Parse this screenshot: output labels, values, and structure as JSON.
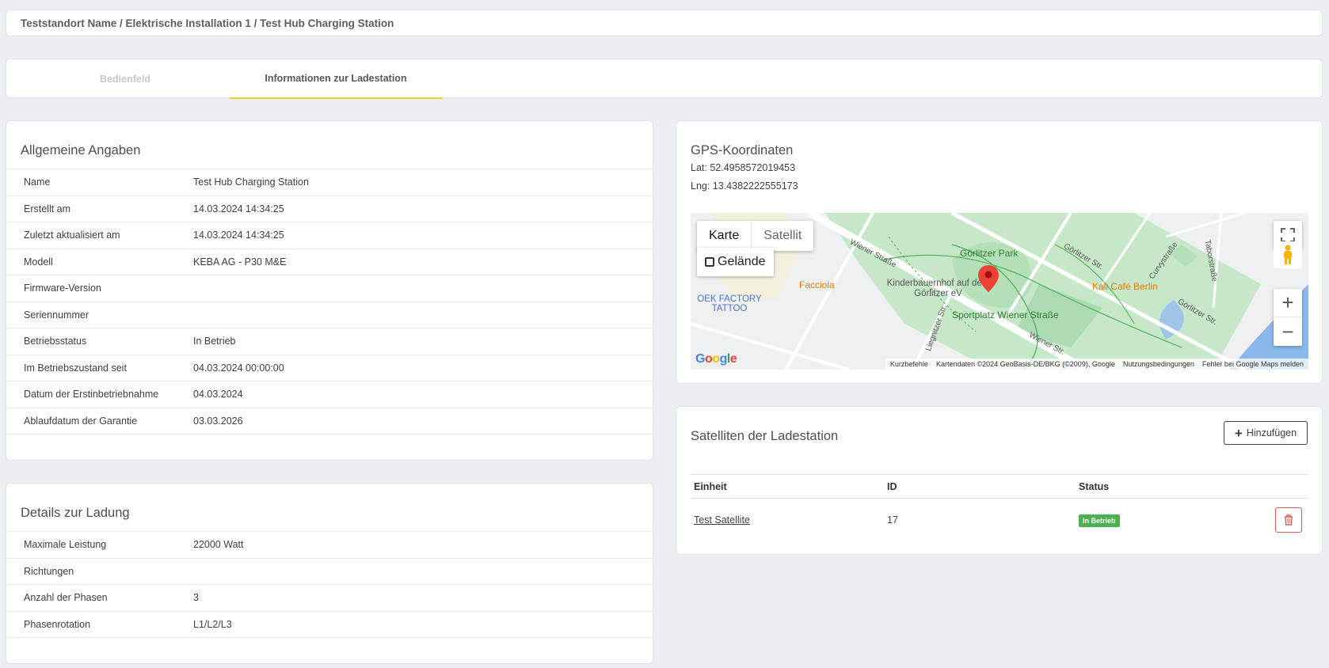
{
  "breadcrumb": "Teststandort Name / Elektrische Installation 1 / Test Hub Charging Station",
  "tabs": [
    {
      "label": "Bedienfeld",
      "active": false
    },
    {
      "label": "Informationen zur Ladestation",
      "active": true
    }
  ],
  "general": {
    "title": "Allgemeine Angaben",
    "rows": [
      {
        "key": "Name",
        "value": "Test Hub Charging Station"
      },
      {
        "key": "Erstellt am",
        "value": "14.03.2024 14:34:25"
      },
      {
        "key": "Zuletzt aktualisiert am",
        "value": "14.03.2024 14:34:25"
      },
      {
        "key": "Modell",
        "value": "KEBA AG - P30 M&E"
      },
      {
        "key": "Firmware-Version",
        "value": ""
      },
      {
        "key": "Seriennummer",
        "value": ""
      },
      {
        "key": "Betriebsstatus",
        "value": "In Betrieb"
      },
      {
        "key": "Im Betriebszustand seit",
        "value": "04.03.2024 00:00:00"
      },
      {
        "key": "Datum der Erstinbetriebnahme",
        "value": "04.03.2024"
      },
      {
        "key": "Ablaufdatum der Garantie",
        "value": "03.03.2026"
      }
    ]
  },
  "charging": {
    "title": "Details zur Ladung",
    "rows": [
      {
        "key": "Maximale Leistung",
        "value": "22000 Watt"
      },
      {
        "key": "Richtungen",
        "value": ""
      },
      {
        "key": "Anzahl der Phasen",
        "value": "3"
      },
      {
        "key": "Phasenrotation",
        "value": "L1/L2/L3"
      }
    ]
  },
  "gps": {
    "title": "GPS-Koordinaten",
    "lat": "Lat: 52.4958572019453",
    "lng": "Lng: 13.4382222555173",
    "map": {
      "type_map": "Karte",
      "type_satellite": "Satellit",
      "terrain": "Gelände",
      "labels": {
        "park": "Görlitzer Park",
        "farm": "Kinderbauernhof auf dem Görlitzer eV",
        "facciola": "Facciola",
        "oek": "OEK FACTORY TATTOO",
        "sportplatz": "Sportplatz Wiener Straße",
        "kali": "Kali Café Berlin",
        "wiener1": "Wiener Straße",
        "wiener2": "Wiener Str.",
        "goerlitzer1": "Görlitzer Str.",
        "goerlitzer2": "Görlitzer Str.",
        "curvy": "Curvystraße",
        "tabor": "Taborstraße",
        "liegnitzer": "Liegnitzer Str."
      },
      "footer": {
        "shortcuts": "Kurzbefehle",
        "data": "Kartendaten ©2024 GeoBasis-DE/BKG (©2009), Google",
        "terms": "Nutzungsbedingungen",
        "report": "Fehler bei Google Maps melden"
      },
      "google": "Google"
    }
  },
  "satellites": {
    "title": "Satelliten der Ladestation",
    "add_label": "Hinzufügen",
    "columns": [
      "Einheit",
      "ID",
      "Status"
    ],
    "rows": [
      {
        "unit": "Test Satellite",
        "id": "17",
        "status": "In Betrieb"
      }
    ]
  },
  "colors": {
    "accent_tab": "#e6d11f",
    "status_badge": "#4caf50",
    "delete": "#e05a5a"
  }
}
